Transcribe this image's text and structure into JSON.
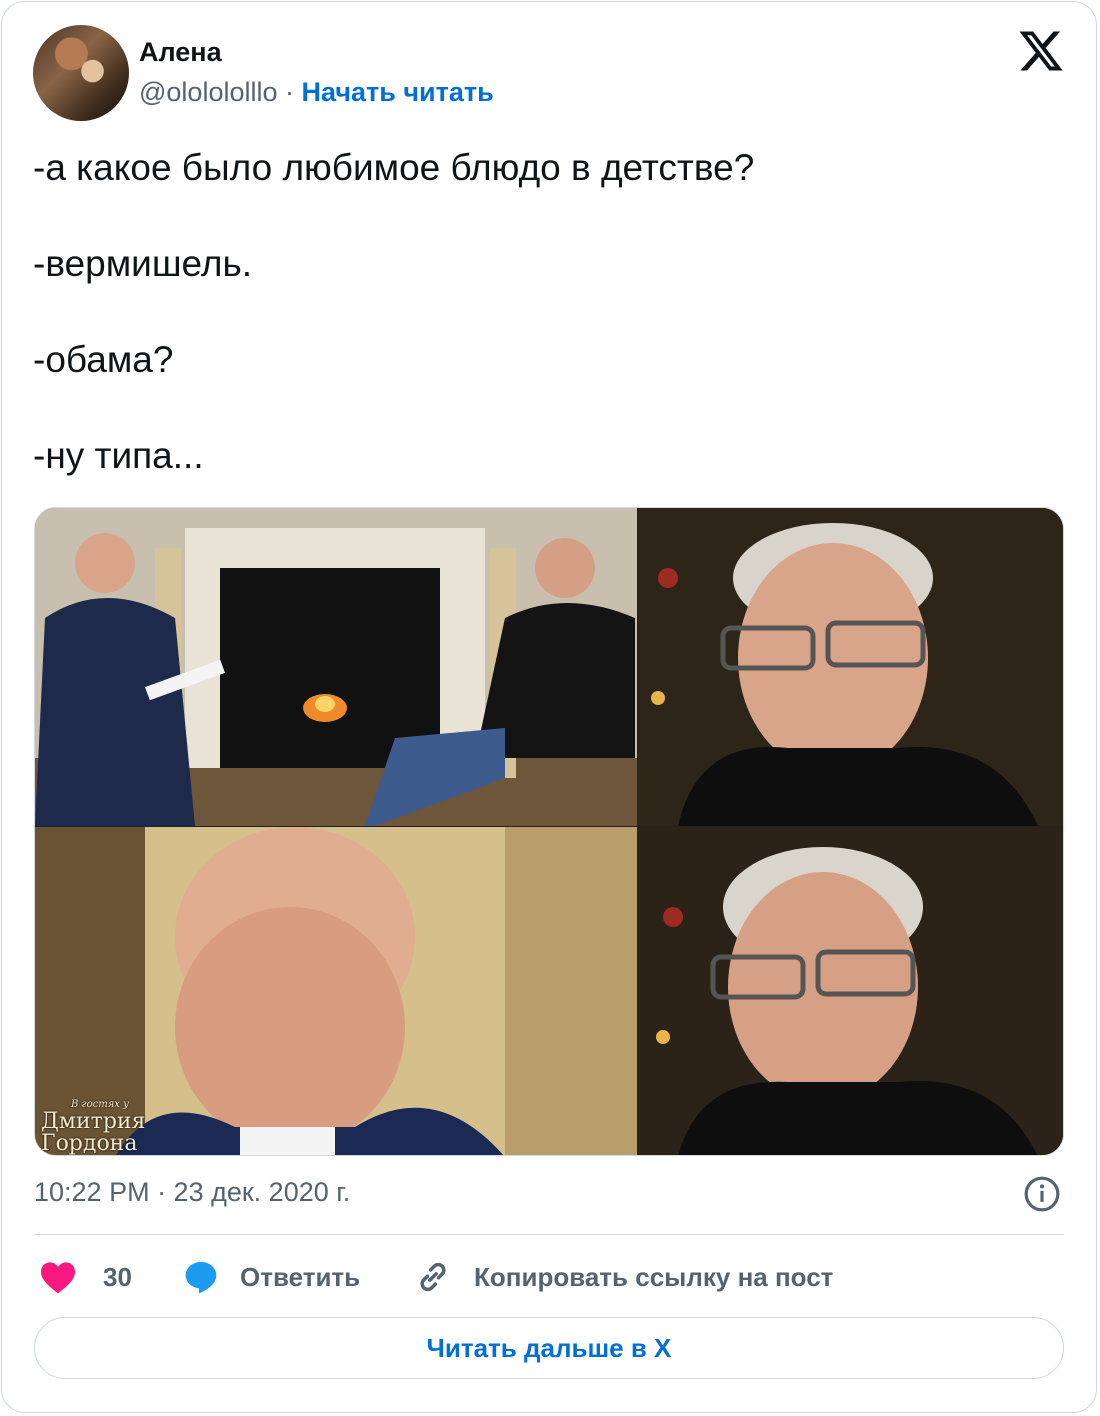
{
  "author": {
    "name": "Алена",
    "handle": "@ololololllo",
    "separator": "·",
    "follow_label": "Начать читать"
  },
  "tweet": {
    "lines": [
      "-а какое было любимое блюдо в детстве?",
      "-вермишель.",
      "-обама?",
      "-ну типа..."
    ]
  },
  "media": {
    "watermark_small": "В гостях у",
    "watermark_line1": "Дмитрия",
    "watermark_line2": "Гордона"
  },
  "meta": {
    "timestamp": "10:22 PM · 23 дек. 2020 г."
  },
  "actions": {
    "like_count": "30",
    "reply_label": "Ответить",
    "copy_label": "Копировать ссылку на пост"
  },
  "read_more_label": "Читать дальше в X",
  "colors": {
    "accent": "#006fd6",
    "like": "#f91880",
    "reply": "#1d9bf0",
    "secondary_text": "#536471",
    "border": "#cfd9de"
  },
  "icons": [
    "x-logo-icon",
    "info-icon",
    "heart-icon",
    "speech-bubble-icon",
    "link-icon"
  ]
}
